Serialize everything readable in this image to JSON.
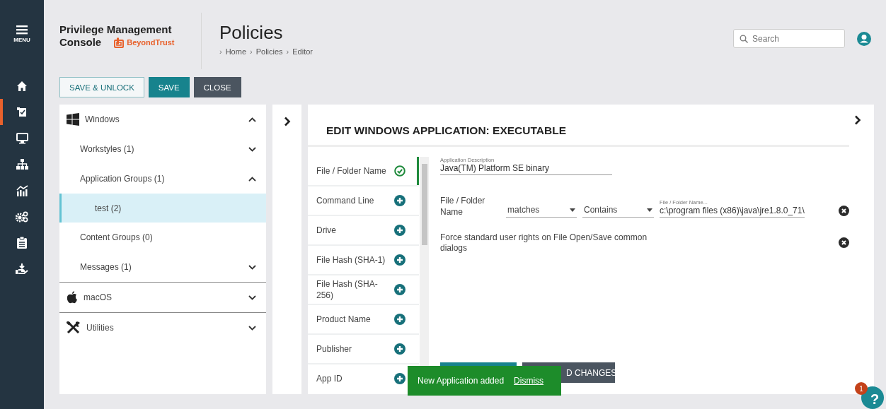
{
  "nav": {
    "menu_label": "MENU",
    "items": [
      {
        "kind": "home",
        "selected": false
      },
      {
        "kind": "policies",
        "selected": true
      },
      {
        "kind": "computers",
        "selected": false
      },
      {
        "kind": "groups",
        "selected": false
      },
      {
        "kind": "analytics",
        "selected": false
      },
      {
        "kind": "settings",
        "selected": false
      },
      {
        "kind": "tasks",
        "selected": false
      },
      {
        "kind": "deploy",
        "selected": false
      }
    ]
  },
  "header": {
    "product_lines": [
      "Privilege Management",
      "Console"
    ],
    "brand": "BeyondTrust",
    "title": "Policies",
    "breadcrumb_separator": "›",
    "breadcrumb": [
      "Home",
      "Policies",
      "Editor"
    ],
    "search": {
      "placeholder": "Search"
    }
  },
  "toolbar": [
    {
      "label": "SAVE & UNLOCK",
      "kind": "outline"
    },
    {
      "label": "SAVE",
      "kind": "primary"
    },
    {
      "label": "CLOSE",
      "kind": "dark"
    }
  ],
  "tree": [
    {
      "label": "Windows",
      "kind": "windows",
      "expanded": true,
      "children": [
        {
          "label": "Workstyles (1)",
          "expanded": false,
          "selected": false
        },
        {
          "label": "Application Groups (1)",
          "expanded": true,
          "selected": false,
          "children": [
            {
              "label": "test (2)",
              "selected": true
            }
          ]
        },
        {
          "label": "Content Groups (0)",
          "selected": false
        },
        {
          "label": "Messages (1)",
          "expanded": false,
          "selected": false
        }
      ]
    },
    {
      "label": "macOS",
      "kind": "apple",
      "expanded": false
    },
    {
      "label": "Utilities",
      "kind": "tools",
      "expanded": false
    }
  ],
  "editor": {
    "title": "EDIT WINDOWS APPLICATION: EXECUTABLE",
    "criteria": [
      {
        "label": "File / Folder Name",
        "added": true
      },
      {
        "label": "Command Line",
        "added": false
      },
      {
        "label": "Drive",
        "added": false
      },
      {
        "label": "File Hash (SHA-1)",
        "added": false
      },
      {
        "label": "File Hash (SHA-256)",
        "added": false
      },
      {
        "label": "Product Name",
        "added": false
      },
      {
        "label": "Publisher",
        "added": false
      },
      {
        "label": "App ID",
        "added": false
      }
    ],
    "description": {
      "label": "Application Description",
      "value": "Java(TM) Platform SE binary"
    },
    "rules": [
      {
        "kind": "match",
        "label": "File / Folder Name",
        "operator": "matches",
        "mode": "Contains",
        "field_label": "File / Folder Name...",
        "value": "c:\\program files (x86)\\java\\jre1.8.0_71\\"
      },
      {
        "kind": "option",
        "label": "Force standard user rights on File Open/Save common dialogs"
      }
    ],
    "buttons": [
      {
        "kind": "primary"
      },
      {
        "kind": "dark",
        "label": "D CHANGES"
      }
    ]
  },
  "toast": {
    "message": "New Application added",
    "action": "Dismiss"
  },
  "help": {
    "badge": "1",
    "label": "?"
  }
}
